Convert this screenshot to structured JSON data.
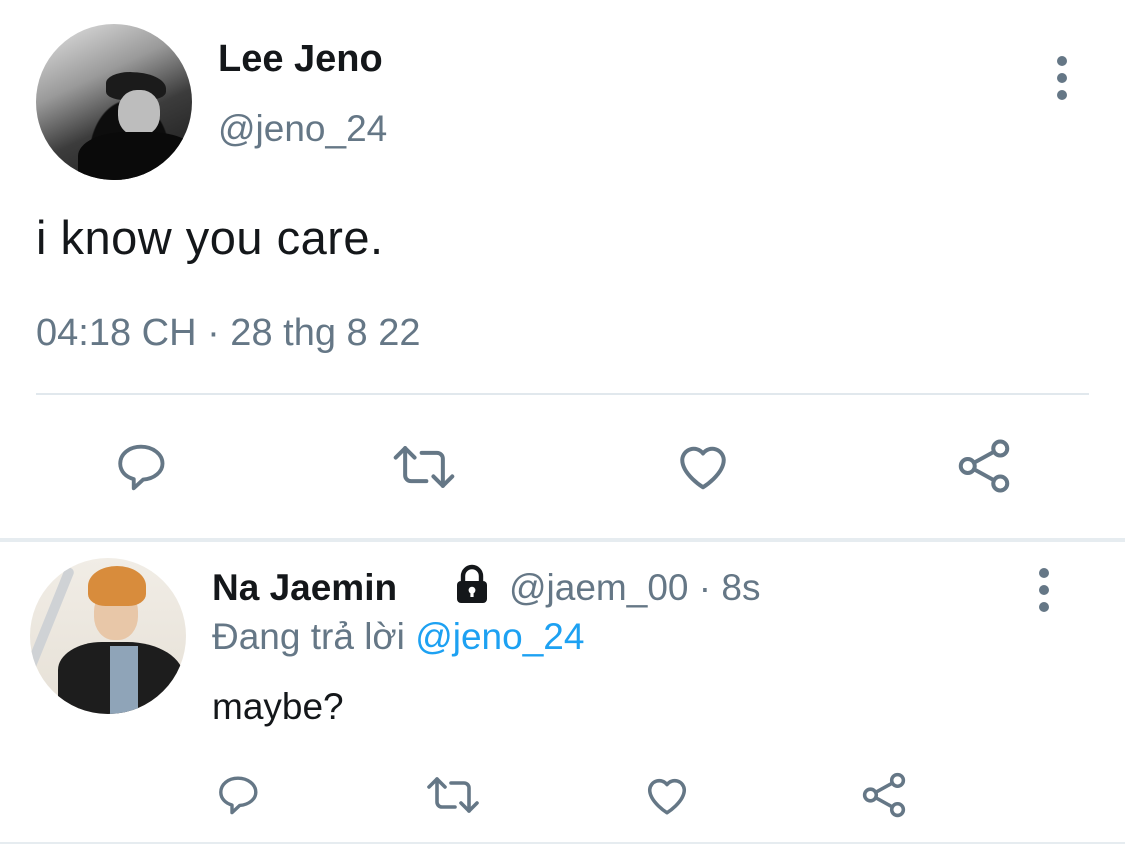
{
  "main_tweet": {
    "display_name": "Lee Jeno",
    "handle": "@jeno_24",
    "text": "i know you care.",
    "timestamp": "04:18 CH · 28 thg 8 22",
    "actions": [
      "reply-icon",
      "retweet-icon",
      "like-icon",
      "share-icon"
    ]
  },
  "reply": {
    "display_name": "Na Jaemin",
    "handle_time": "@jaem_00 · 8s",
    "replying_prefix": "Đang trả lời ",
    "replying_mention": "@jeno_24",
    "text": "maybe?",
    "actions": [
      "reply-icon",
      "retweet-icon",
      "like-icon",
      "share-icon"
    ]
  },
  "colors": {
    "text_primary": "#14171a",
    "text_secondary": "#657786",
    "link": "#1da1f2",
    "divider": "#e1e8ed"
  }
}
